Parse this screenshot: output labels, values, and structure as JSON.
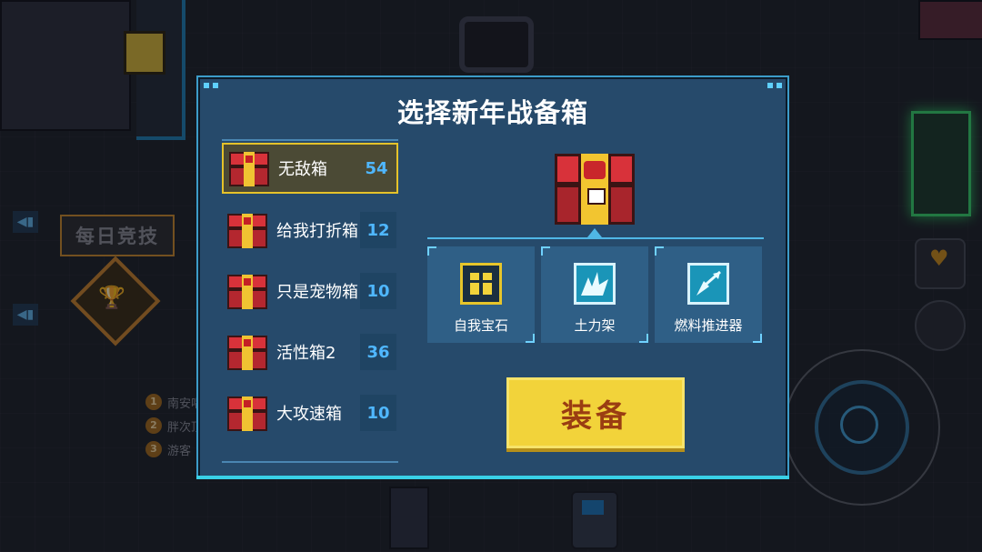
{
  "background": {
    "daily_banner": "每日竞技",
    "ranks": [
      {
        "num": "1",
        "name": "南安唱"
      },
      {
        "num": "2",
        "name": "胖次顶"
      },
      {
        "num": "3",
        "name": "游客"
      }
    ]
  },
  "modal": {
    "title": "选择新年战备箱",
    "chests": [
      {
        "label": "无敌箱",
        "count": "54",
        "selected": true
      },
      {
        "label": "给我打折箱",
        "count": "12",
        "selected": false
      },
      {
        "label": "只是宠物箱",
        "count": "10",
        "selected": false
      },
      {
        "label": "活性箱2",
        "count": "36",
        "selected": false
      },
      {
        "label": "大攻速箱",
        "count": "10",
        "selected": false
      }
    ],
    "skills": [
      {
        "label": "自我宝石",
        "icon": "gem-box-icon"
      },
      {
        "label": "土力架",
        "icon": "burst-icon"
      },
      {
        "label": "燃料推进器",
        "icon": "thruster-icon"
      }
    ],
    "equip_label": "装备"
  },
  "colors": {
    "panel": "#264a6b",
    "accent": "#39d0e6",
    "selected_border": "#e5c22a",
    "count_text": "#4fb7ff",
    "equip_bg": "#f2d33a",
    "equip_text": "#9a3d12"
  }
}
